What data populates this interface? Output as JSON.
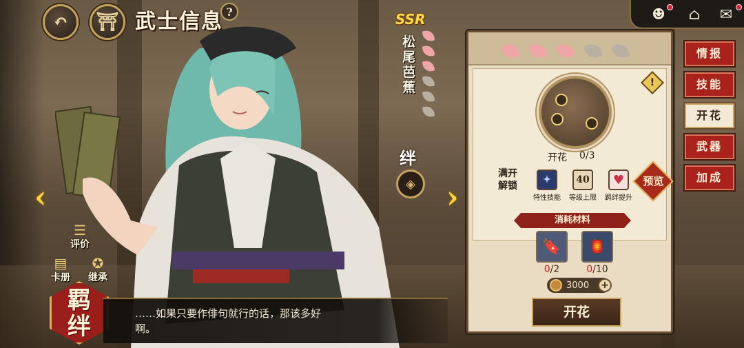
{
  "header": {
    "title": "武士信息",
    "help": "?"
  },
  "character": {
    "rarity": "SSR",
    "name_chars": [
      "松",
      "尾",
      "芭",
      "蕉"
    ],
    "bond_glyph": "绊",
    "bloom_progress": 3,
    "bloom_max": 6
  },
  "left_buttons": {
    "review": "评价",
    "album": "卡册",
    "inherit": "继承"
  },
  "bond_emblem": [
    "羁",
    "绊"
  ],
  "dialog": {
    "line1": "……如果只要作俳句就行的话，那该多好",
    "line2": "啊。"
  },
  "panel": {
    "bloom_label": "开花",
    "bloom_count": "0/3",
    "unlock_head": "满开解锁",
    "unlocks": [
      {
        "label": "特性技能",
        "icon": "skill-icon"
      },
      {
        "label": "等级上限",
        "icon": "level-cap-icon",
        "value": "40"
      },
      {
        "label": "羁绊提升",
        "icon": "heart-icon"
      }
    ],
    "preview": "预览",
    "materials_title": "消耗材料",
    "materials": [
      {
        "have": "0",
        "need": "/2",
        "icon": "talisman-icon"
      },
      {
        "have": "0",
        "need": "/10",
        "icon": "lantern-icon"
      }
    ],
    "coin_amount": "3000",
    "action_button": "开花"
  },
  "side_tabs": [
    {
      "label": "情报",
      "active": false
    },
    {
      "label": "技能",
      "active": false
    },
    {
      "label": "开花",
      "active": true
    },
    {
      "label": "武器",
      "active": false
    },
    {
      "label": "加成",
      "active": false
    }
  ],
  "colors": {
    "petal_active": "#f0a6a6",
    "petal_inactive": "#b8b0a0",
    "accent_red": "#a9231c",
    "gold": "#c9a55f"
  }
}
